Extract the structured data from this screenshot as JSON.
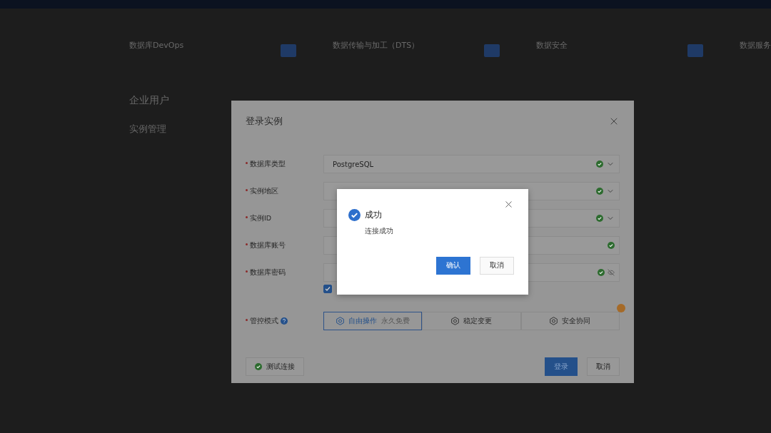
{
  "background": {
    "tiles": [
      {
        "title": "数据库DevOps"
      },
      {
        "title": "数据传输与加工（DTS）"
      },
      {
        "title": "数据安全"
      },
      {
        "title": "数据服务"
      }
    ],
    "section_title": "企业用户",
    "section_item": "实例管理"
  },
  "dialog": {
    "title": "登录实例",
    "fields": [
      {
        "label": "数据库类型",
        "kind": "select",
        "value": "PostgreSQL",
        "valid": true,
        "required": true
      },
      {
        "label": "实例地区",
        "kind": "select",
        "valid": true,
        "required": true
      },
      {
        "label": "实例ID",
        "kind": "select",
        "valid": true,
        "required": true
      },
      {
        "label": "数据库账号",
        "kind": "text",
        "valid": true,
        "required": true
      },
      {
        "label": "数据库密码",
        "kind": "password",
        "valid": true,
        "required": true
      }
    ],
    "remember_checked": true,
    "mode": {
      "label": "管控模式",
      "required": true,
      "options": [
        {
          "label": "自由操作",
          "note": "永久免费",
          "selected": true
        },
        {
          "label": "稳定变更",
          "selected": false
        },
        {
          "label": "安全协同",
          "selected": false
        }
      ]
    },
    "test_button": {
      "label": "测试连接",
      "passed": true
    },
    "buttons": [
      {
        "label": "登录",
        "kind": "primary"
      },
      {
        "label": "取消",
        "kind": "default"
      }
    ]
  },
  "popup": {
    "title": "成功",
    "message": "连接成功",
    "buttons": [
      {
        "label": "确认",
        "kind": "primary"
      },
      {
        "label": "取消",
        "kind": "default"
      }
    ]
  }
}
